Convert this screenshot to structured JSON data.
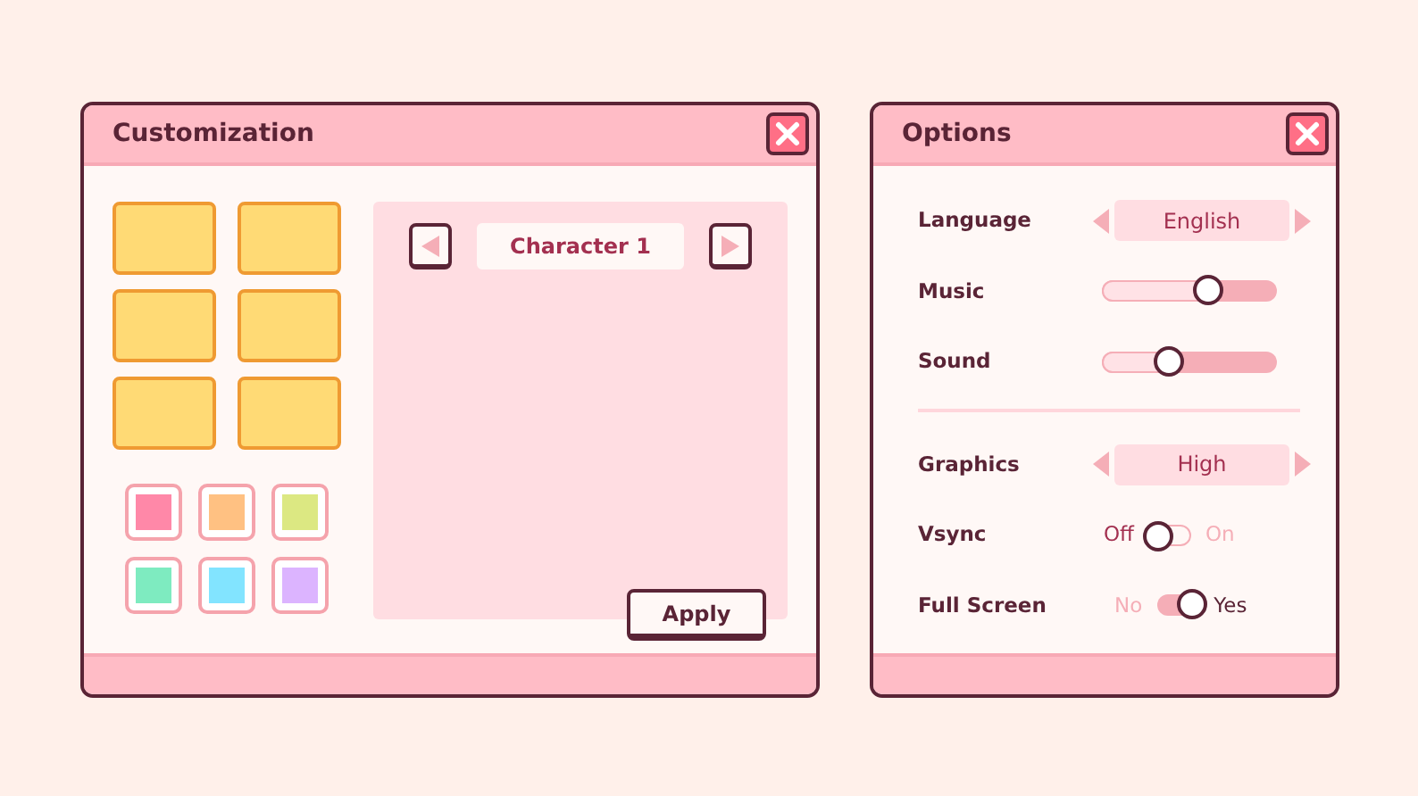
{
  "customization": {
    "title": "Customization",
    "character": {
      "label": "Character 1"
    },
    "swatches": [
      {
        "color": "#ff88a8"
      },
      {
        "color": "#ffc182"
      },
      {
        "color": "#dce882"
      },
      {
        "color": "#7eebc0"
      },
      {
        "color": "#82e4ff"
      },
      {
        "color": "#dcb4ff"
      }
    ],
    "apply_button": "Apply"
  },
  "options": {
    "title": "Options",
    "sections": [
      [
        {
          "kind": "selector",
          "label": "Language",
          "value": "English"
        },
        {
          "kind": "slider",
          "label": "Music",
          "level": 0.6
        },
        {
          "kind": "slider",
          "label": "Sound",
          "level": 0.38
        }
      ],
      [
        {
          "kind": "selector",
          "label": "Graphics",
          "value": "High"
        },
        {
          "kind": "toggle",
          "label": "Vsync",
          "off_label": "Off",
          "on_label": "On",
          "on": false
        },
        {
          "kind": "toggle",
          "label": "Full Screen",
          "off_label": "No",
          "on_label": "Yes",
          "on": true
        }
      ]
    ]
  }
}
